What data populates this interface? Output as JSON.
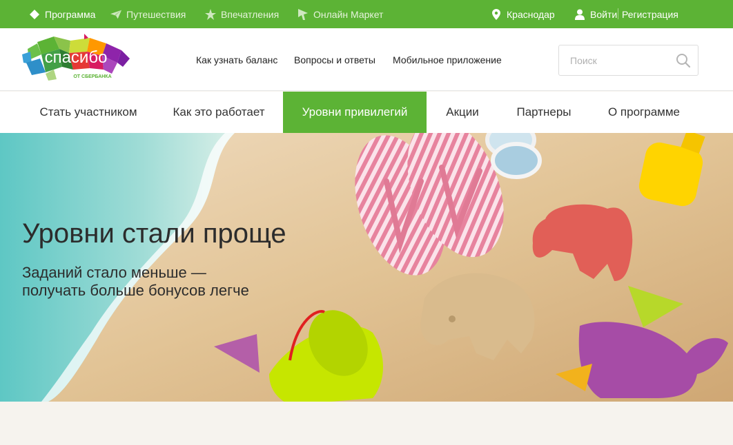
{
  "topbar": {
    "items": [
      {
        "label": "Программа",
        "icon": "diamond-icon"
      },
      {
        "label": "Путешествия",
        "icon": "plane-icon"
      },
      {
        "label": "Впечатления",
        "icon": "star-icon"
      },
      {
        "label": "Онлайн Маркет",
        "icon": "cursor-icon"
      }
    ],
    "city": "Краснодар",
    "login": "Войти",
    "register": "Регистрация"
  },
  "header": {
    "logo": {
      "main": "спасибо",
      "sub": "ОТ СБЕРБАНКА"
    },
    "links": [
      "Как узнать баланс",
      "Вопросы и ответы",
      "Мобильное приложение"
    ],
    "search_placeholder": "Поиск"
  },
  "nav": {
    "items": [
      "Стать участником",
      "Как это работает",
      "Уровни привилегий",
      "Акции",
      "Партнеры",
      "О программе"
    ],
    "active_index": 2
  },
  "hero": {
    "title": "Уровни стали проще",
    "subtitle_line1": "Заданий стало меньше —",
    "subtitle_line2": "получать больше бонусов легче"
  },
  "colors": {
    "brand_green": "#5cb335",
    "text_dark": "#2c2c2c",
    "page_bg": "#f6f3ee"
  }
}
